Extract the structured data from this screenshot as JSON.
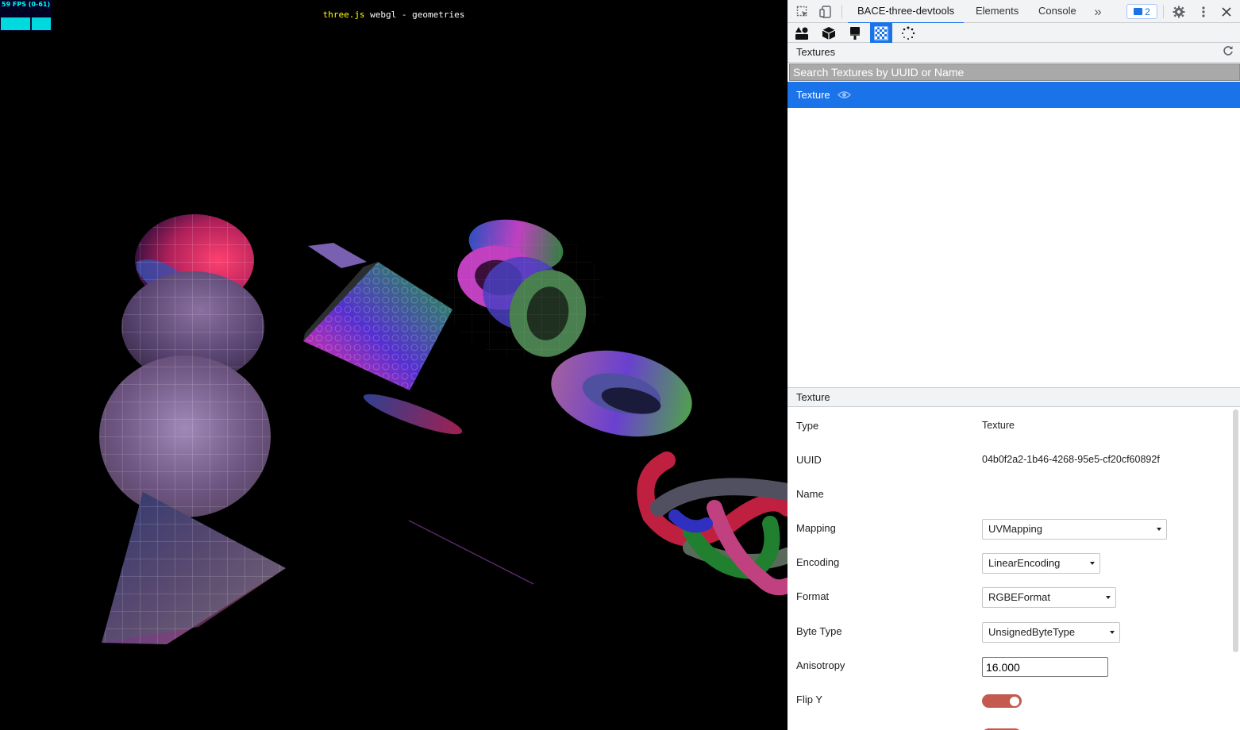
{
  "viewport": {
    "fps": "59 FPS (0-61)",
    "info_link": "three.js",
    "info_rest": " webgl - geometries"
  },
  "devtools": {
    "tabs": [
      "BACE-three-devtools",
      "Elements",
      "Console"
    ],
    "issues_count": "2",
    "tools": [
      "objects-icon",
      "geometry-icon",
      "material-icon",
      "texture-icon",
      "loading-icon"
    ],
    "textures_header": "Textures",
    "search_placeholder": "Search Textures by UUID or Name",
    "list": [
      {
        "label": "Texture"
      }
    ],
    "detail_header": "Texture",
    "props": {
      "type_label": "Type",
      "type_value": "Texture",
      "uuid_label": "UUID",
      "uuid_value": "04b0f2a2-1b46-4268-95e5-cf20cf60892f",
      "name_label": "Name",
      "name_value": "",
      "mapping_label": "Mapping",
      "mapping_value": "UVMapping",
      "encoding_label": "Encoding",
      "encoding_value": "LinearEncoding",
      "format_label": "Format",
      "format_value": "RGBEFormat",
      "bytetype_label": "Byte Type",
      "bytetype_value": "UnsignedByteType",
      "anisotropy_label": "Anisotropy",
      "anisotropy_value": "16.000",
      "flipy_label": "Flip Y",
      "flipy_value": true
    },
    "colors": {
      "accent": "#1a73e8",
      "toggle_on": "#c4594f"
    }
  }
}
